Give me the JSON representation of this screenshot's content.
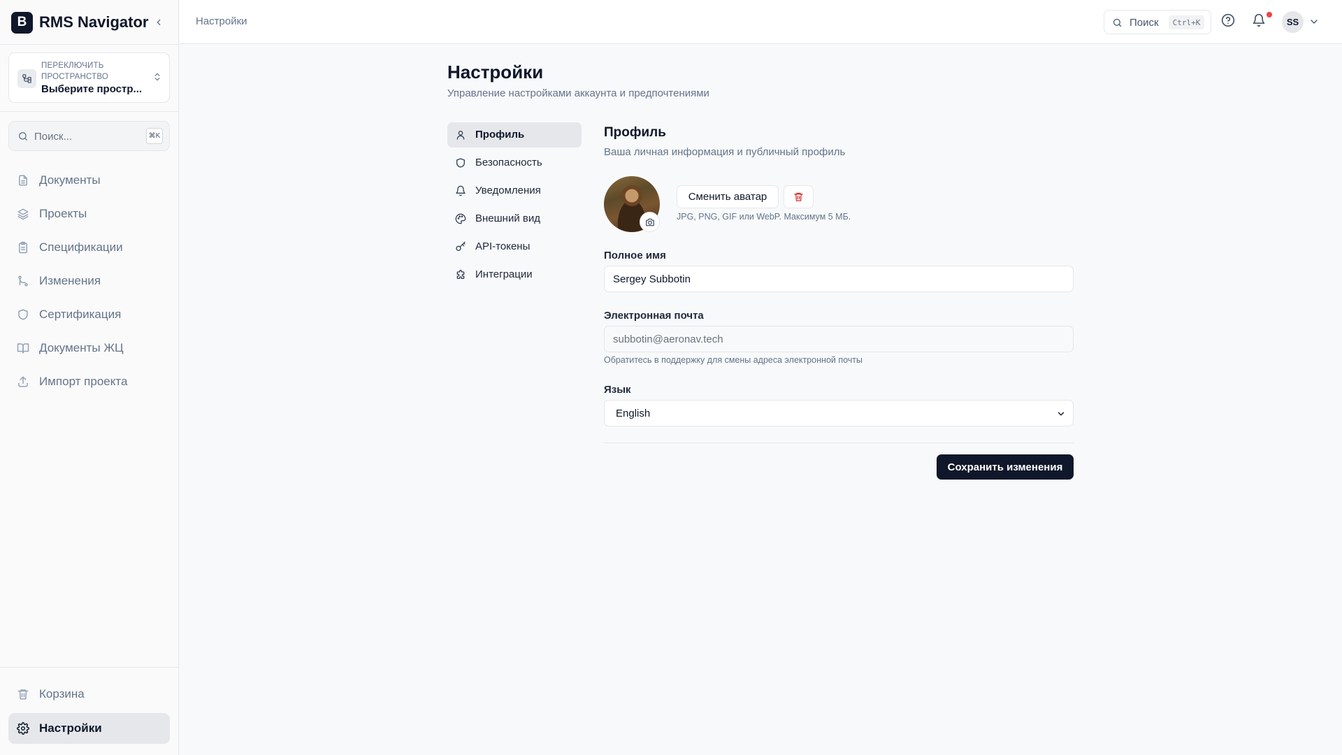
{
  "app": {
    "logo_letter": "B",
    "name": "RMS Navigator"
  },
  "sidebar": {
    "workspace": {
      "caption": "Переключить пространство",
      "value": "Выберите простр..."
    },
    "search": {
      "placeholder": "Поиск...",
      "shortcut": "⌘K"
    },
    "items": [
      {
        "label": "Документы",
        "icon": "file-text-icon"
      },
      {
        "label": "Проекты",
        "icon": "layers-icon"
      },
      {
        "label": "Спецификации",
        "icon": "clipboard-icon"
      },
      {
        "label": "Изменения",
        "icon": "git-branch-icon"
      },
      {
        "label": "Сертификация",
        "icon": "shield-icon"
      },
      {
        "label": "Документы ЖЦ",
        "icon": "book-open-icon"
      },
      {
        "label": "Импорт проекта",
        "icon": "upload-icon"
      }
    ],
    "bottom_items": [
      {
        "label": "Корзина",
        "icon": "trash-icon"
      },
      {
        "label": "Настройки",
        "icon": "gear-icon",
        "active": true
      }
    ]
  },
  "header": {
    "breadcrumb": "Настройки",
    "search_label": "Поиск",
    "search_shortcut": "Ctrl+K",
    "user_initials": "SS",
    "has_notification": true
  },
  "page": {
    "title": "Настройки",
    "subtitle": "Управление настройками аккаунта и предпочтениями"
  },
  "settings_nav": [
    {
      "label": "Профиль",
      "icon": "user-icon",
      "active": true
    },
    {
      "label": "Безопасность",
      "icon": "shield-icon"
    },
    {
      "label": "Уведомления",
      "icon": "bell-icon"
    },
    {
      "label": "Внешний вид",
      "icon": "palette-icon"
    },
    {
      "label": "API-токены",
      "icon": "key-icon"
    },
    {
      "label": "Интеграции",
      "icon": "puzzle-icon"
    }
  ],
  "profile": {
    "title": "Профиль",
    "subtitle": "Ваша личная информация и публичный профиль",
    "change_avatar_label": "Сменить аватар",
    "avatar_hint": "JPG, PNG, GIF или WebP. Максимум 5 МБ.",
    "full_name_label": "Полное имя",
    "full_name_value": "Sergey Subbotin",
    "email_label": "Электронная почта",
    "email_value": "subbotin@aeronav.tech",
    "email_note": "Обратитесь в поддержку для смены адреса электронной почты",
    "language_label": "Язык",
    "language_value": "English",
    "save_label": "Сохранить изменения"
  },
  "colors": {
    "primary": "#0f172a",
    "danger": "#dc2626",
    "notification_dot": "#ef4444",
    "border": "#e5e7eb",
    "muted_text": "#64748b"
  }
}
